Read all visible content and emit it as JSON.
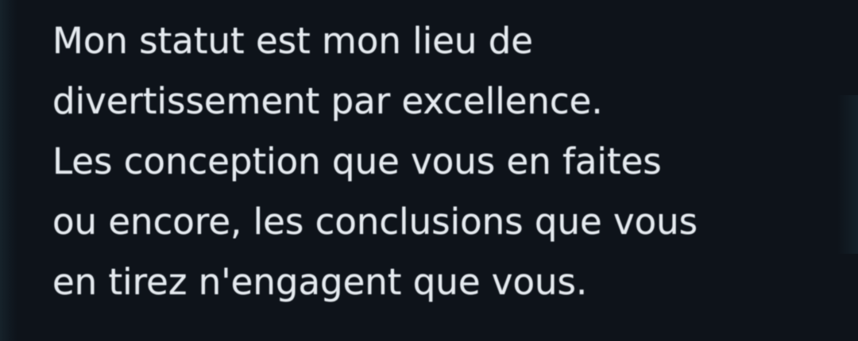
{
  "tweet": {
    "lines": [
      "Mon statut est mon lieu de",
      "divertissement par excellence.",
      "Les conception que vous en faites",
      "ou encore, les conclusions que vous",
      "en tirez n'engagent que vous."
    ]
  },
  "colors": {
    "background": "#0e131a",
    "text": "#e4e9ee"
  }
}
